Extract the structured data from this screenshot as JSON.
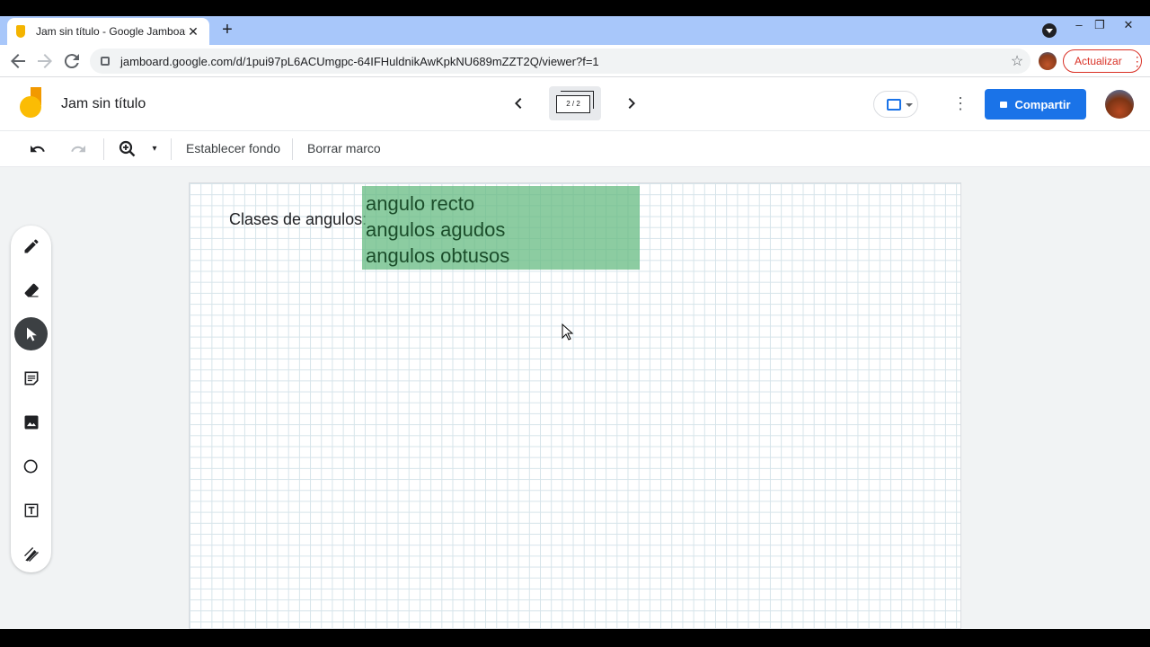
{
  "browser": {
    "tab_title": "Jam sin título - Google Jamboard",
    "tab_close": "✕",
    "new_tab": "+",
    "win_min": "‒",
    "win_restore": "❐",
    "win_close": "✕",
    "url": "jamboard.google.com/d/1pui97pL6ACUmgpc-64IFHuldnikAwKpkNU689mZZT2Q/viewer?f=1",
    "update_label": "Actualizar",
    "update_menu": "⋮",
    "star": "☆"
  },
  "header": {
    "title": "Jam sin título",
    "frame_indicator": "2 / 2",
    "share_label": "Compartir",
    "prev": "‹",
    "next": "›",
    "kebab": "⋮"
  },
  "edit_toolbar": {
    "undo": "↶",
    "redo": "↷",
    "zoom": "⌕",
    "zoom_caret": "▾",
    "set_background": "Establecer fondo",
    "clear_frame": "Borrar marco"
  },
  "board": {
    "text": "Clases de angulos:",
    "sticky_lines": [
      "angulo recto",
      "angulos agudos",
      "angulos obtusos"
    ],
    "sticky_color": "#66bb82"
  },
  "tools": [
    "pen-icon",
    "eraser-icon",
    "select-icon",
    "sticky-note-icon",
    "image-icon",
    "circle-icon",
    "text-box-icon",
    "laser-icon"
  ],
  "colors": {
    "accent": "#1a73e8",
    "update_red": "#d93025"
  }
}
